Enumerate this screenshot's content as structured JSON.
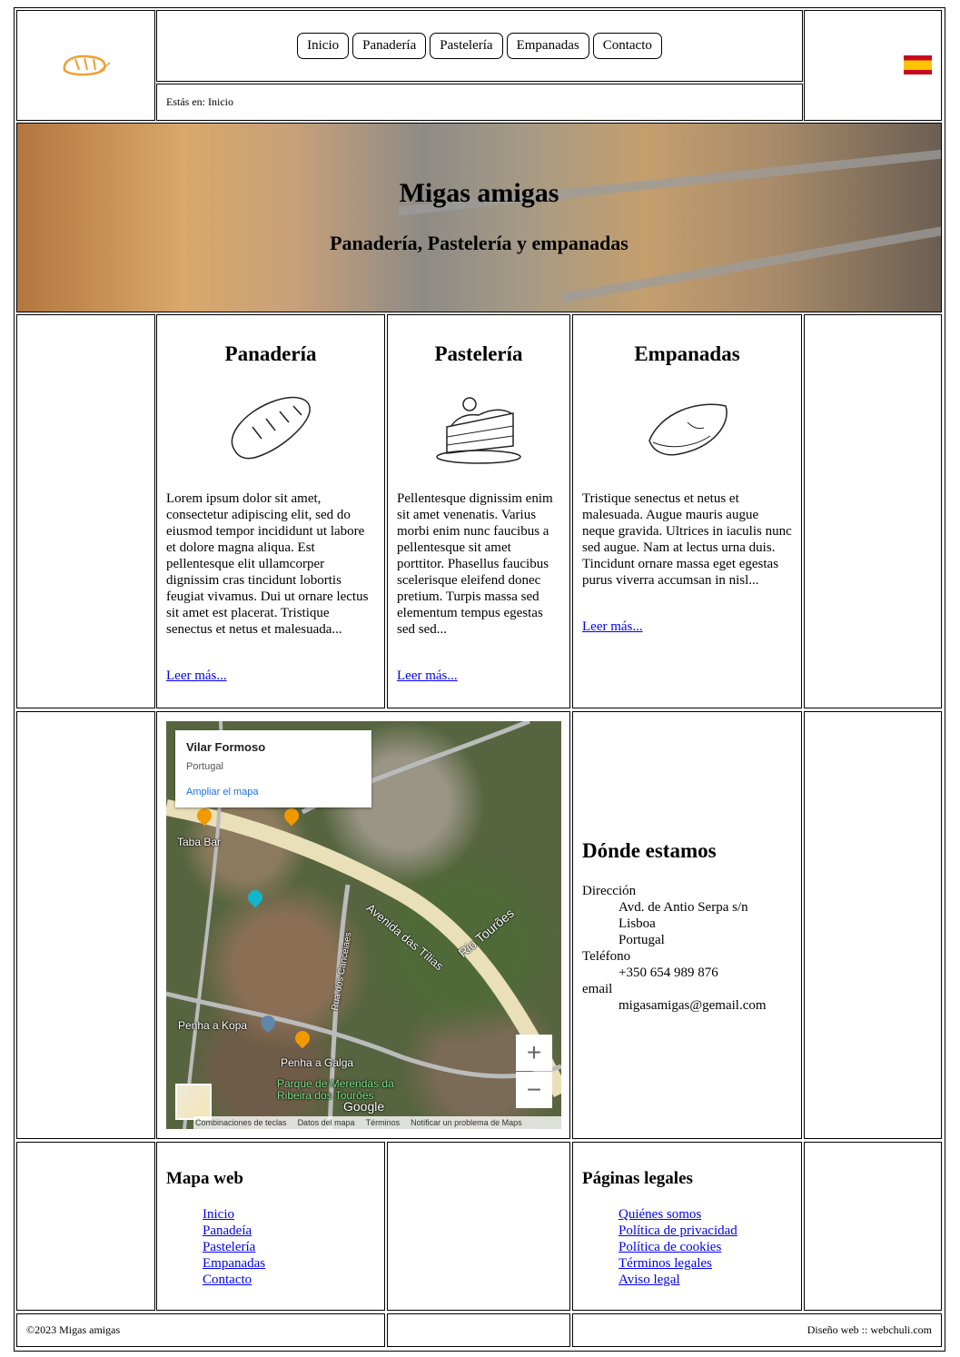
{
  "nav": {
    "items": [
      "Inicio",
      "Panadería",
      "Pastelería",
      "Empanadas",
      "Contacto"
    ]
  },
  "breadcrumb": "Estás en: Inicio",
  "hero": {
    "title": "Migas amigas",
    "subtitle": "Panadería, Pastelería y empanadas"
  },
  "products": [
    {
      "title": "Panadería",
      "icon": "bread-icon",
      "text": "Lorem ipsum dolor sit amet, consectetur adipiscing elit, sed do eiusmod tempor incididunt ut labore et dolore magna aliqua. Est pellentesque elit ullamcorper dignissim cras tincidunt lobortis feugiat vivamus. Dui ut ornare lectus sit amet est placerat. Tristique senectus et netus et malesuada...",
      "link": "Leer más..."
    },
    {
      "title": "Pastelería",
      "icon": "cake-icon",
      "text": "Pellentesque dignissim enim sit amet venenatis. Varius morbi enim nunc faucibus a pellentesque sit amet porttitor. Phasellus faucibus scelerisque eleifend donec pretium. Turpis massa sed elementum tempus egestas sed sed...",
      "link": "Leer más..."
    },
    {
      "title": "Empanadas",
      "icon": "empanada-icon",
      "text": "Tristique senectus et netus et malesuada. Augue mauris augue neque gravida. Ultrices in iaculis nunc sed augue. Nam at lectus urna duis. Tincidunt ornare massa eget egestas purus viverra accumsan in nisl...",
      "link": "Leer más..."
    }
  ],
  "map": {
    "place": "Vilar Formoso",
    "country": "Portugal",
    "expand": "Ampliar el mapa",
    "labels": [
      "Taba Bar",
      "Avenida das Tílias",
      "Rio Tourões",
      "Rua dos Canceiaes",
      "Penha a Kopa",
      "Penha a Galga",
      "Parque de Merendas da Ribeira dos Tourões",
      "Google"
    ],
    "zoom_in": "+",
    "zoom_out": "−",
    "footer": [
      "Combinaciones de teclas",
      "Datos del mapa",
      "Términos",
      "Notificar un problema de Maps"
    ]
  },
  "location": {
    "title": "Dónde estamos",
    "address_label": "Dirección",
    "address": [
      "Avd. de Antio Serpa s/n",
      "Lisboa",
      "Portugal"
    ],
    "phone_label": "Teléfono",
    "phone": "+350 654 989 876",
    "email_label": "email",
    "email": "migasamigas@gemail.com"
  },
  "sitemap": {
    "title": "Mapa web",
    "links": [
      "Inicio",
      "Panadeía",
      "Pastelería",
      "Empanadas",
      "Contacto"
    ]
  },
  "legal": {
    "title": "Páginas legales",
    "links": [
      "Quiénes somos",
      "Política de privacidad",
      "Política de cookies",
      "Términos legales",
      "Aviso legal"
    ]
  },
  "footer": {
    "copyright": "©2023 Migas amigas",
    "credit": "Diseño web :: webchuli.com"
  },
  "colors": {
    "link": "#0000ee",
    "flag_red": "#c60b1e",
    "flag_yellow": "#ffc400",
    "logo": "#f0a030"
  }
}
